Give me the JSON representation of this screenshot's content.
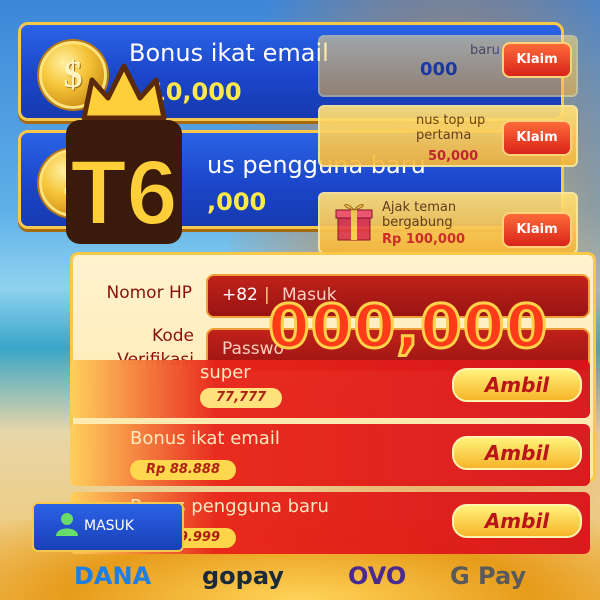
{
  "banners": [
    {
      "title": "Bonus ikat email",
      "amount": "10,000"
    },
    {
      "title": "us pengguna baru",
      "amount": ",000"
    }
  ],
  "cards": [
    {
      "text": "baru",
      "amount": "000",
      "button": "Klaim"
    },
    {
      "text": "nus top up pertama",
      "amount": "50,000",
      "button": "Klaim"
    },
    {
      "text": "Ajak teman bergabung",
      "amount": "Rp 100,000",
      "button": "Klaim"
    }
  ],
  "form": {
    "phone_label": "Nomor HP",
    "phone_prefix": "+82",
    "phone_placeholder": "Masuk",
    "code_label_line1": "Kode",
    "code_label_line2": "Verifikasi",
    "code_placeholder": "Passwo"
  },
  "big_number": "000,000",
  "rewards": [
    {
      "title": "super",
      "amount": "77,777",
      "button": "Ambil"
    },
    {
      "title": "Bonus ikat email",
      "amount": "Rp 88.888",
      "button": "Ambil"
    },
    {
      "title": "Bonus pengguna baru",
      "amount": "Rp 99.999",
      "button": "Ambil"
    }
  ],
  "login_button": "MASUK",
  "payments": [
    "DANA",
    "gopay",
    "OVO",
    "G Pay"
  ],
  "logo_text": "T6",
  "colors": {
    "banner_blue": "#1b46c9",
    "gold": "#f7c84a",
    "red": "#d8141a",
    "yellow_text": "#ffe84a"
  }
}
